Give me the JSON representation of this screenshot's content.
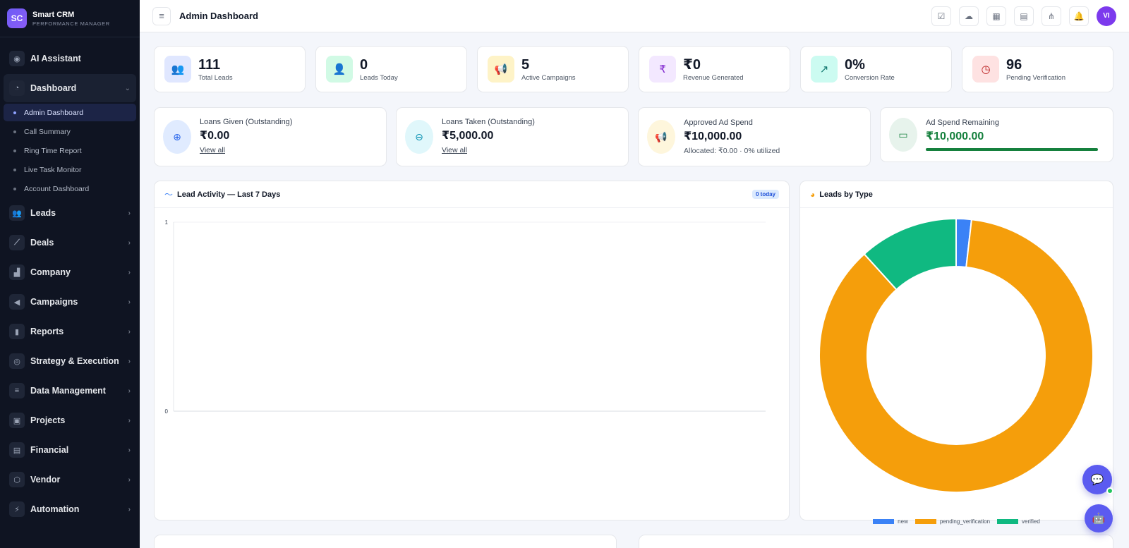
{
  "brand": {
    "logo": "SC",
    "title": "Smart CRM",
    "subtitle": "PERFORMANCE MANAGER"
  },
  "sidebar": {
    "items": [
      {
        "label": "AI Assistant",
        "icon": "robot-icon"
      },
      {
        "label": "Dashboard",
        "icon": "gauge-icon",
        "expanded": true,
        "children": [
          "Admin Dashboard",
          "Call Summary",
          "Ring Time Report",
          "Live Task Monitor",
          "Account Dashboard"
        ]
      },
      {
        "label": "Leads",
        "icon": "users-icon"
      },
      {
        "label": "Deals",
        "icon": "chart-line-icon"
      },
      {
        "label": "Company",
        "icon": "building-icon"
      },
      {
        "label": "Campaigns",
        "icon": "megaphone-icon"
      },
      {
        "label": "Reports",
        "icon": "bar-chart-icon"
      },
      {
        "label": "Strategy & Execution",
        "icon": "target-icon"
      },
      {
        "label": "Data Management",
        "icon": "database-icon"
      },
      {
        "label": "Projects",
        "icon": "project-icon"
      },
      {
        "label": "Financial",
        "icon": "ledger-icon"
      },
      {
        "label": "Vendor",
        "icon": "box-icon"
      },
      {
        "label": "Automation",
        "icon": "bolt-icon"
      }
    ]
  },
  "header": {
    "title": "Admin Dashboard",
    "avatar": "VI"
  },
  "stats": [
    {
      "value": "111",
      "label": "Total Leads",
      "icon": "users-icon",
      "bg": "#e0e7ff",
      "fg": "#4338ca"
    },
    {
      "value": "0",
      "label": "Leads Today",
      "icon": "user-plus-icon",
      "bg": "#d1fae5",
      "fg": "#047857"
    },
    {
      "value": "5",
      "label": "Active Campaigns",
      "icon": "megaphone-icon",
      "bg": "#fef3c7",
      "fg": "#b45309"
    },
    {
      "value": "₹0",
      "label": "Revenue Generated",
      "icon": "rupee-icon",
      "bg": "#f3e8ff",
      "fg": "#7e22ce"
    },
    {
      "value": "0%",
      "label": "Conversion Rate",
      "icon": "trend-up-icon",
      "bg": "#ccfbf1",
      "fg": "#0f766e"
    },
    {
      "value": "96",
      "label": "Pending Verification",
      "icon": "clock-icon",
      "bg": "#fee2e2",
      "fg": "#b91c1c"
    }
  ],
  "finance": {
    "loans_given": {
      "title": "Loans Given (Outstanding)",
      "value": "₹0.00",
      "link": "View all"
    },
    "loans_taken": {
      "title": "Loans Taken (Outstanding)",
      "value": "₹5,000.00",
      "link": "View all"
    },
    "ad_spend": {
      "title": "Approved Ad Spend",
      "value": "₹10,000.00",
      "note": "Allocated: ₹0.00 · 0% utilized"
    },
    "ad_remaining": {
      "title": "Ad Spend Remaining",
      "value": "₹10,000.00",
      "progress": 1.0
    }
  },
  "lead_activity": {
    "title": "Lead Activity — Last 7 Days",
    "badge": "0 today"
  },
  "leads_by_type": {
    "title": "Leads by Type"
  },
  "chart_data": [
    {
      "type": "line",
      "ylim": [
        0,
        1
      ],
      "yticks": [
        "0",
        "1"
      ],
      "series": []
    },
    {
      "type": "pie",
      "donut": true,
      "labels": [
        "new",
        "pending_verification",
        "verified"
      ],
      "values": [
        2,
        96,
        13
      ],
      "colors": [
        "#3b82f6",
        "#f59e0b",
        "#10b981"
      ],
      "legend": "bottom"
    }
  ]
}
